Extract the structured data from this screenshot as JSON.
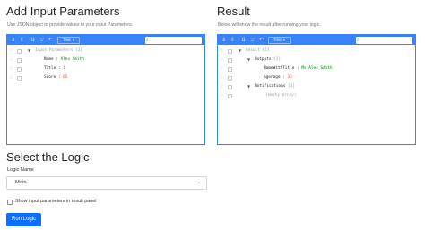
{
  "input_panel": {
    "title": "Add Input Parameters",
    "hint": "Use JSON object to provide values to your input Parameters.",
    "menubar": {
      "mode_label": "Tree",
      "icons": [
        "expand-all-icon",
        "collapse-all-icon",
        "sort-icon",
        "filter-icon",
        "undo-icon",
        "redo-icon",
        "search-icon"
      ]
    },
    "tree": {
      "root_key": "Input Parameters",
      "root_count": "{3}",
      "fields": [
        {
          "key": "Name",
          "sep": " : ",
          "value": "Alex Smith",
          "type": "string"
        },
        {
          "key": "Title",
          "sep": " : ",
          "value": "1",
          "type": "number"
        },
        {
          "key": "Score",
          "sep": " : ",
          "value": "65",
          "type": "number"
        }
      ]
    }
  },
  "result_panel": {
    "title": "Result",
    "hint": "Below will show the result after running your logic.",
    "menubar": {
      "mode_label": "Tree"
    },
    "tree": {
      "root_key": "Result",
      "root_count": "{2}",
      "outputs_key": "Outputs",
      "outputs_count": "{2}",
      "outputs": [
        {
          "key": "NameWithTitle",
          "sep": " : ",
          "value": "Ms Alex Smith",
          "type": "string"
        },
        {
          "key": "Agerage",
          "sep": " : ",
          "value": "33",
          "type": "number"
        }
      ],
      "notifications_key": "Notifications",
      "notifications_count": "[0]",
      "empty_text": "(empty array)"
    }
  },
  "logic": {
    "title": "Select the Logic",
    "logic_name_label": "Logic Name",
    "selected_logic": "Main",
    "show_input_label": "Show input parameters in result panel",
    "show_input_checked": false,
    "run_label": "Run Logic"
  },
  "colors": {
    "editor_accent": "#3883fa",
    "string_value": "#008000",
    "number_value": "#ee422e",
    "primary_button": "#0d6efd"
  }
}
